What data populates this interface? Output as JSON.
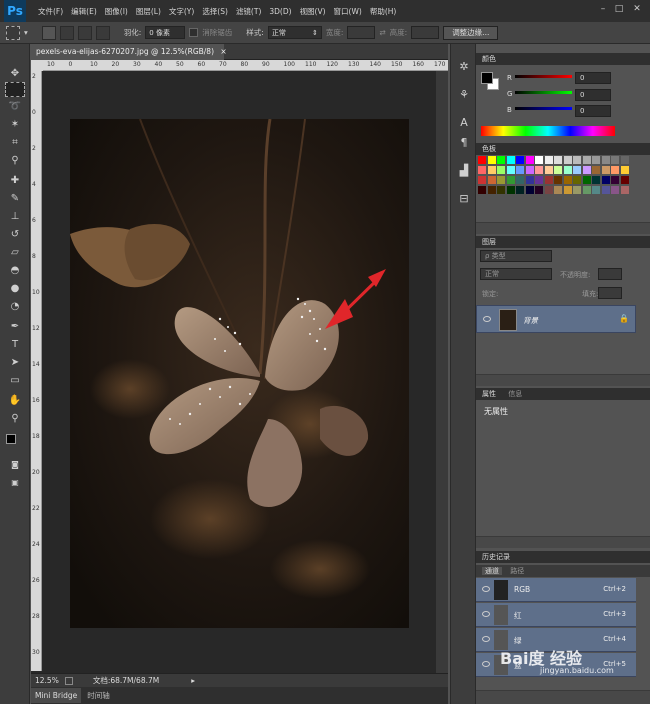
{
  "app": {
    "logo": "Ps",
    "accent": "#31a8ff"
  },
  "menu": [
    "文件(F)",
    "编辑(E)",
    "图像(I)",
    "图层(L)",
    "文字(Y)",
    "选择(S)",
    "滤镜(T)",
    "3D(D)",
    "视图(V)",
    "窗口(W)",
    "帮助(H)"
  ],
  "window_controls": {
    "minimize": "–",
    "maximize": "□",
    "close": "✕"
  },
  "options": {
    "feather_label": "羽化:",
    "feather_value": "0 像素",
    "antialias_label": "消除锯齿",
    "style_label": "样式:",
    "style_value": "正常",
    "width_label": "宽度:",
    "height_label": "高度:",
    "refine_edge": "调整边缘..."
  },
  "document": {
    "tab_title": "pexels-eva-elijas-6270207.jpg @ 12.5%(RGB/8)",
    "tab_close": "×",
    "ruler_h": [
      "10",
      "0",
      "10",
      "20",
      "30",
      "40",
      "50",
      "60",
      "70",
      "80",
      "90",
      "100",
      "110",
      "120",
      "130",
      "140",
      "150",
      "160",
      "170"
    ],
    "ruler_v": [
      "2",
      "0",
      "2",
      "4",
      "6",
      "8",
      "10",
      "12",
      "14",
      "16",
      "18",
      "20",
      "22",
      "24",
      "26",
      "28",
      "30"
    ]
  },
  "status": {
    "zoom": "12.5%",
    "doc_info": "文档:68.7M/68.7M"
  },
  "bottom_tabs": [
    "Mini Bridge",
    "时间轴"
  ],
  "color_panel": {
    "title": "颜色",
    "r_label": "R",
    "r_value": "0",
    "g_label": "G",
    "g_value": "0",
    "b_label": "B",
    "b_value": "0"
  },
  "swatches_panel": {
    "title": "色板"
  },
  "layers_panel": {
    "title": "图层",
    "filter_label": "ρ 类型",
    "blend_mode": "正常",
    "opacity_label": "不透明度:",
    "lock_label": "锁定:",
    "fill_label": "填充:",
    "layer_name": "背景"
  },
  "properties_panel": {
    "title": "属性",
    "tab2": "信息",
    "content": "无属性"
  },
  "history_panel": {
    "title": "历史记录"
  },
  "channels_panel": {
    "tab1": "通道",
    "tab2": "路径",
    "channels": [
      {
        "name": "RGB",
        "key": "Ctrl+2"
      },
      {
        "name": "红",
        "key": "Ctrl+3"
      },
      {
        "name": "绿",
        "key": "Ctrl+4"
      },
      {
        "name": "蓝",
        "key": "Ctrl+5"
      }
    ]
  },
  "watermark": {
    "brand": "Bai度 经验",
    "url": "jingyan.baidu.com"
  }
}
